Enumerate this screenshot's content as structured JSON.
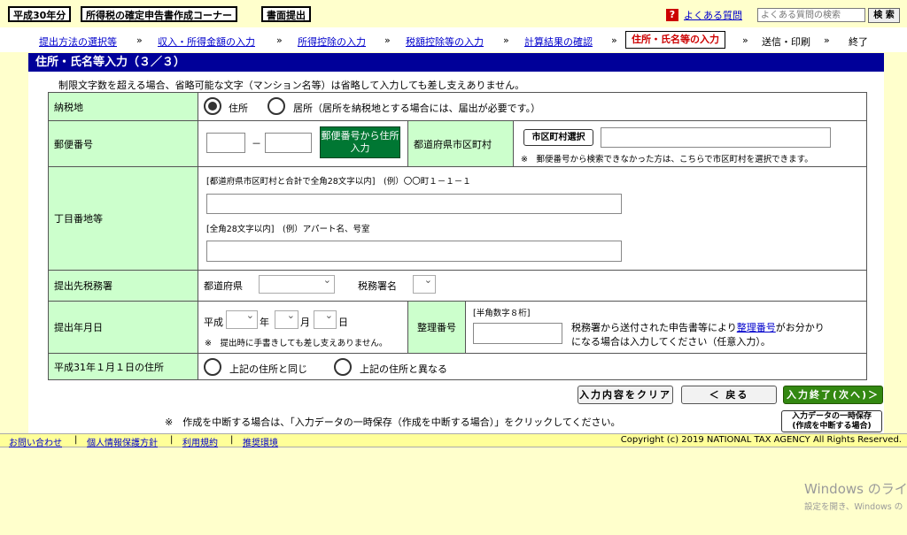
{
  "topbar": {
    "year": "平成30年分",
    "corner": "所得税の確定申告書作成コーナー",
    "mode": "書面提出",
    "faq_icon": "?",
    "faq_link": "よくある質問",
    "faq_placeholder": "よくある質問の検索",
    "search_button": "検 索"
  },
  "steps": {
    "items": [
      "提出方法の選択等",
      "収入・所得金額の入力",
      "所得控除の入力",
      "税額控除等の入力",
      "計算結果の確認",
      "住所・氏名等の入力",
      "送信・印刷",
      "終了"
    ],
    "separator": "»",
    "current_index": 5
  },
  "page_title": "住所・氏名等入力（３／３）",
  "note_top": "制限文字数を超える場合、省略可能な文字（マンション名等）は省略して入力しても差し支えありません。",
  "form": {
    "nozeichi": {
      "label": "納税地",
      "opt1": "住所",
      "opt2": "居所（居所を納税地とする場合には、届出が必要です。）"
    },
    "postal": {
      "label": "郵便番号",
      "dash": "－",
      "button": "郵便番号から住所入力",
      "pref_label": "都道府県市区町村",
      "city_button": "市区町村選択",
      "note": "※　郵便番号から検索できなかった方は、こちらで市区町村を選択できます。"
    },
    "address": {
      "label": "丁目番地等",
      "hint1": "[都道府県市区町村と合計で全角28文字以内]　(例）〇〇町１－１－１",
      "hint2": "[全角28文字以内]　(例）アパート名、号室"
    },
    "office": {
      "label": "提出先税務署",
      "pref": "都道府県",
      "office_name": "税務署名"
    },
    "date": {
      "label": "提出年月日",
      "era": "平成",
      "year": "年",
      "month": "月",
      "day": "日",
      "note": "※　提出時に手書きしても差し支えありません。",
      "seiri_label": "整理番号",
      "seiri_hint": "[半角数字８桁]",
      "seiri_text1": "税務署から送付された申告書等により",
      "seiri_link": "整理番号",
      "seiri_text2": "がお分かり",
      "seiri_text3": "になる場合は入力してください（任意入力）。"
    },
    "jan1": {
      "label": "平成31年１月１日の住所",
      "opt1": "上記の住所と同じ",
      "opt2": "上記の住所と異なる"
    }
  },
  "buttons": {
    "clear": "入力内容をクリア",
    "back": "＜ 戻る",
    "next": "入力終了(次へ)＞",
    "save": "入力データの一時保存",
    "save_sub": "(作成を中断する場合)"
  },
  "bottom_note": "※　作成を中断する場合は、「入力データの一時保存（作成を中断する場合）」をクリックしてください。",
  "footer": {
    "links": [
      "お問い合わせ",
      "個人情報保護方針",
      "利用規約",
      "推奨環境"
    ],
    "copyright": "Copyright (c) 2019 NATIONAL TAX AGENCY All Rights Reserved."
  },
  "watermark": {
    "line1": "Windows のライセ",
    "line2": "設定を開き、Windows の"
  },
  "colors": {
    "title_bar": "#000099",
    "label_bg": "#ccffcc",
    "current_step": "#cc0000",
    "green_button": "#007733",
    "page_bg": "#ffffcc"
  }
}
